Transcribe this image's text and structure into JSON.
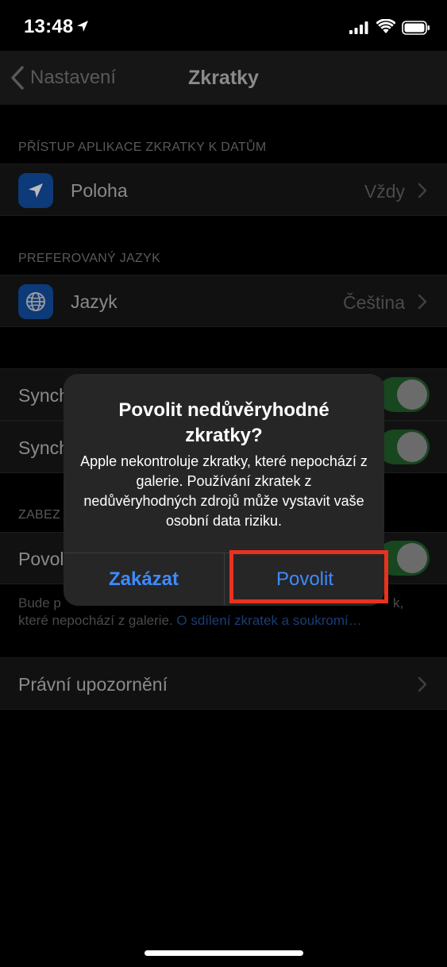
{
  "status_bar": {
    "time": "13:48"
  },
  "nav": {
    "back_label": "Nastavení",
    "title": "Zkratky"
  },
  "sections": {
    "data_access_header": "PŘÍSTUP APLIKACE ZKRATKY K DATŮM",
    "location": {
      "label": "Poloha",
      "value": "Vždy",
      "icon": "location-arrow-icon"
    },
    "language_header": "PREFEROVANÝ JAZYK",
    "language": {
      "label": "Jazyk",
      "value": "Čeština",
      "icon": "globe-icon"
    },
    "sync1_label": "Synch",
    "sync2_label": "Synch",
    "security_header": "ZABEZ",
    "allow_untrusted_label": "Povol",
    "footer_line1": "Bude p",
    "footer_line1_end": "k,",
    "footer_line2": "které nepochází z galerie. ",
    "footer_link": "O sdílení zkratek a soukromí…",
    "legal_label": "Právní upozornění"
  },
  "alert": {
    "title": "Povolit nedůvěryhodné zkratky?",
    "message": "Apple nekontroluje zkratky, které nepochází z galerie. Používání zkratek z nedůvěryhodných zdrojů může vystavit vaše osobní data riziku.",
    "cancel_label": "Zakázat",
    "allow_label": "Povolit"
  },
  "colors": {
    "accent": "#3e8bff",
    "highlight_box": "#e8321f",
    "toggle_on_dimmed": "#18461f"
  }
}
